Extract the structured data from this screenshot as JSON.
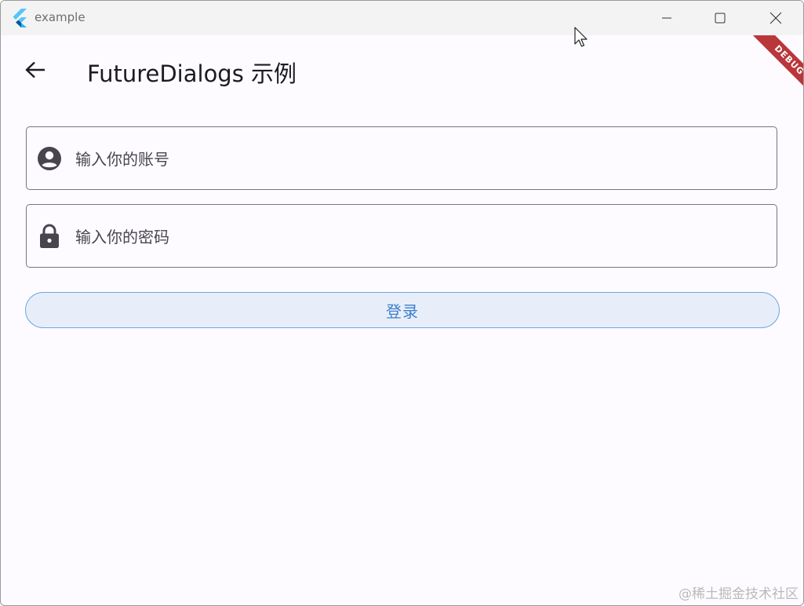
{
  "window": {
    "title": "example"
  },
  "appbar": {
    "title": "FutureDialogs 示例",
    "debug_banner": "DEBUG"
  },
  "form": {
    "account_placeholder": "输入你的账号",
    "password_placeholder": "输入你的密码",
    "login_label": "登录"
  },
  "watermark": "@稀土掘金技术社区",
  "colors": {
    "accent": "#3c7fcc",
    "button_bg": "#e8eef9",
    "debug_ribbon": "#b9363b",
    "field_border": "#79747e",
    "background": "#fdfbff"
  },
  "icons": {
    "app": "flutter-logo-icon",
    "back": "arrow-back-icon",
    "account": "account-circle-icon",
    "password": "lock-icon"
  }
}
